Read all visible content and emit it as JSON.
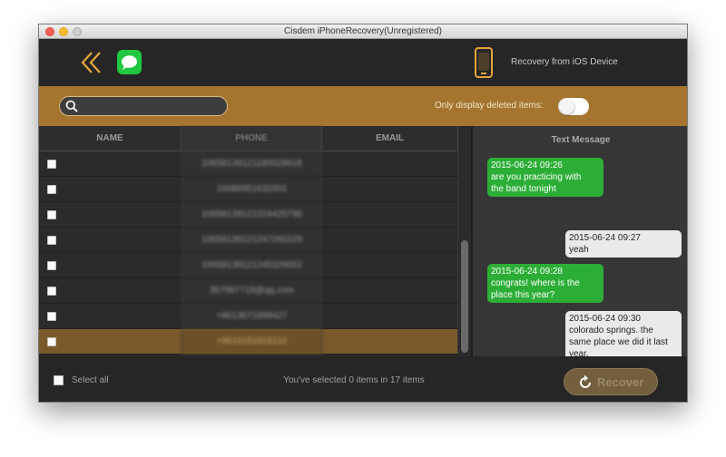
{
  "window": {
    "title": "Cisdem iPhoneRecovery(Unregistered)"
  },
  "topbar": {
    "back_icon": "double-chevron-left-icon",
    "category_icon": "messages-app-icon",
    "device_icon": "iphone-device-icon",
    "device_label": "Recovery from iOS Device"
  },
  "filter": {
    "search_value": "",
    "search_icon": "search-icon",
    "deleted_label": "Only display deleted items:",
    "deleted_toggle_on": false
  },
  "table": {
    "columns": [
      "NAME",
      "PHONE",
      "EMAIL"
    ],
    "rows": [
      {
        "name": "",
        "phone": "10658139121180028618",
        "email": "",
        "checked": false,
        "selected": false
      },
      {
        "name": "",
        "phone": "10086951632001",
        "email": "",
        "checked": false,
        "selected": false
      },
      {
        "name": "",
        "phone": "10658139121224425796",
        "email": "",
        "checked": false,
        "selected": false
      },
      {
        "name": "",
        "phone": "10658139121247260229",
        "email": "",
        "checked": false,
        "selected": false
      },
      {
        "name": "",
        "phone": "10658139121245326052",
        "email": "",
        "checked": false,
        "selected": false
      },
      {
        "name": "",
        "phone": "357987718@qq.com",
        "email": "",
        "checked": false,
        "selected": false
      },
      {
        "name": "",
        "phone": "+8613671698427",
        "email": "",
        "checked": false,
        "selected": false
      },
      {
        "name": "",
        "phone": "+8615151616110",
        "email": "",
        "checked": false,
        "selected": true
      }
    ]
  },
  "messages": {
    "header": "Text Message",
    "items": [
      {
        "time": "2015-06-24 09:26",
        "lines": [
          "are you practicing with",
          "the band tonight"
        ],
        "direction": "received"
      },
      {
        "time": "2015-06-24 09:27",
        "lines": [
          "yeah"
        ],
        "direction": "sent"
      },
      {
        "time": "2015-06-24 09:28",
        "lines": [
          "congrats! where is the",
          "place this year?"
        ],
        "direction": "received"
      },
      {
        "time": "2015-06-24 09:30",
        "lines": [
          "colorado springs. the",
          "same place we did it last",
          "year."
        ],
        "direction": "sent"
      }
    ]
  },
  "footer": {
    "select_all_label": "Select all",
    "status": "You've selected 0 items in 17 items",
    "recover_label": "Recover",
    "recover_icon": "refresh-icon"
  },
  "colors": {
    "accent": "#a57530",
    "selected_row": "#7a5a2b",
    "bubble_received": "#2cae36",
    "bubble_sent": "#eaeaea",
    "recover_button": "#735f3d"
  }
}
